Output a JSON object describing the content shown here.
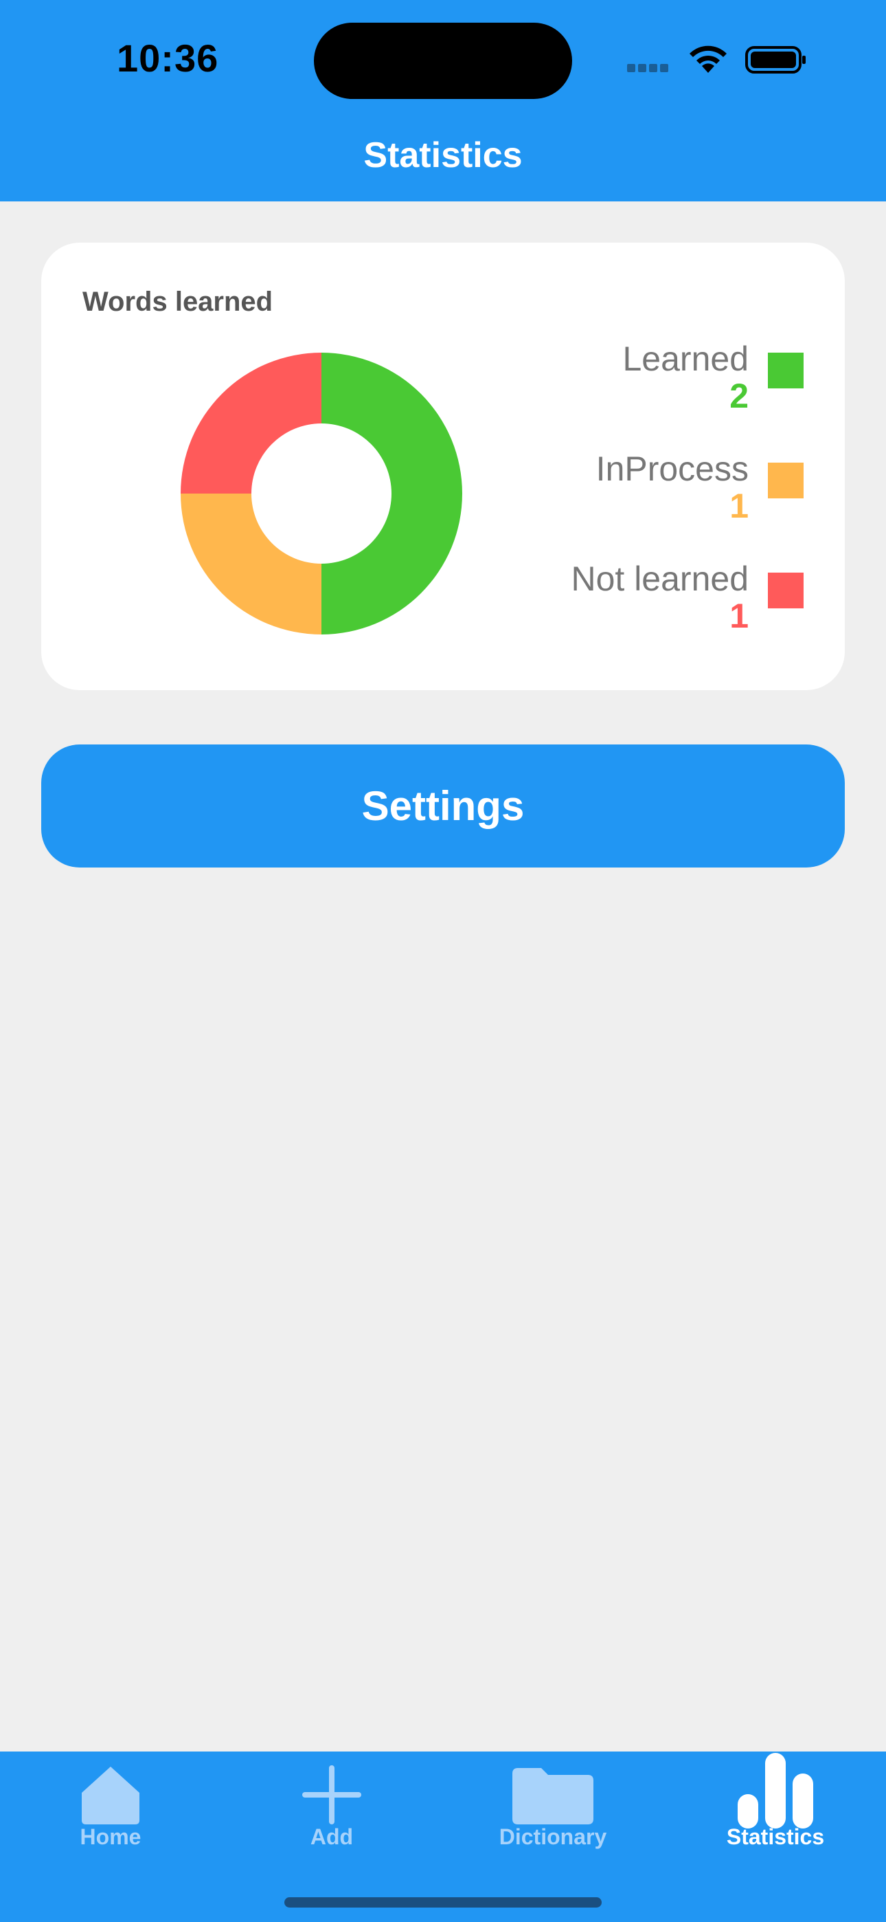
{
  "status_bar": {
    "time": "10:36"
  },
  "nav": {
    "title": "Statistics"
  },
  "chart_data": {
    "type": "pie",
    "title": "Words learned",
    "donut": true,
    "categories": [
      "Learned",
      "InProcess",
      "Not learned"
    ],
    "values": [
      2,
      1,
      1
    ],
    "colors": [
      "#4ac934",
      "#ffb74d",
      "#ff5a5a"
    ],
    "legend_position": "right"
  },
  "card": {
    "title": "Words learned",
    "legend": [
      {
        "label": "Learned",
        "value": "2",
        "color": "#4ac934"
      },
      {
        "label": "InProcess",
        "value": "1",
        "color": "#ffb74d"
      },
      {
        "label": "Not learned",
        "value": "1",
        "color": "#ff5a5a"
      }
    ]
  },
  "settings_button": {
    "label": "Settings"
  },
  "tabbar": {
    "tabs": [
      {
        "label": "Home",
        "icon": "home-icon",
        "active": false
      },
      {
        "label": "Add",
        "icon": "plus-icon",
        "active": false
      },
      {
        "label": "Dictionary",
        "icon": "folder-icon",
        "active": false
      },
      {
        "label": "Statistics",
        "icon": "bar-chart-icon",
        "active": true
      }
    ]
  },
  "colors": {
    "primary": "#2196f3",
    "background": "#efefef",
    "inactive_tab": "#a8d3fb"
  }
}
